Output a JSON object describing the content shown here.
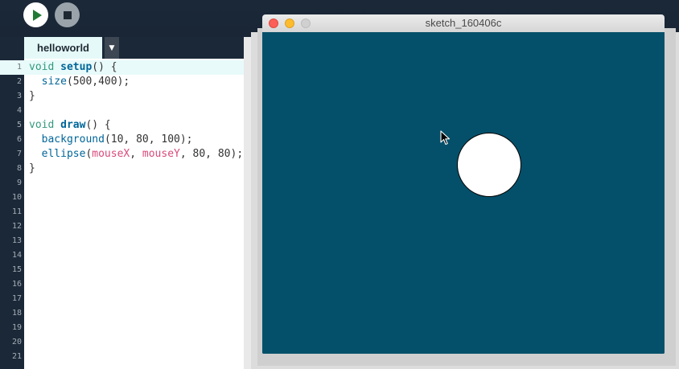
{
  "toolbar": {
    "run_icon": "play-icon",
    "stop_icon": "stop-icon"
  },
  "tabs": {
    "active_label": "helloworld",
    "menu_glyph": "▼"
  },
  "editor": {
    "line_numbers": [
      "1",
      "2",
      "3",
      "4",
      "5",
      "6",
      "7",
      "8",
      "9",
      "10",
      "11",
      "12",
      "13",
      "14",
      "15",
      "16",
      "17",
      "18",
      "19",
      "20",
      "21"
    ],
    "code": {
      "l1": {
        "kw": "void",
        "fn": "setup",
        "rest": "() {"
      },
      "l2": {
        "fn": "size",
        "rest": "(500,400);"
      },
      "l3": {
        "rest": "}"
      },
      "l5": {
        "kw": "void",
        "fn": "draw",
        "rest": "() {"
      },
      "l6": {
        "fn": "background",
        "rest": "(10, 80, 100);"
      },
      "l7": {
        "fn": "ellipse",
        "open": "(",
        "var1": "mouseX",
        "sep": ", ",
        "var2": "mouseY",
        "rest": ", 80, 80);"
      },
      "l8": {
        "rest": "}"
      }
    }
  },
  "sketch_window": {
    "title": "sketch_160406c",
    "background_color": "#04506a"
  },
  "colors": {
    "keyword": "#33997e",
    "function": "#006699",
    "variable": "#d94a7a"
  }
}
